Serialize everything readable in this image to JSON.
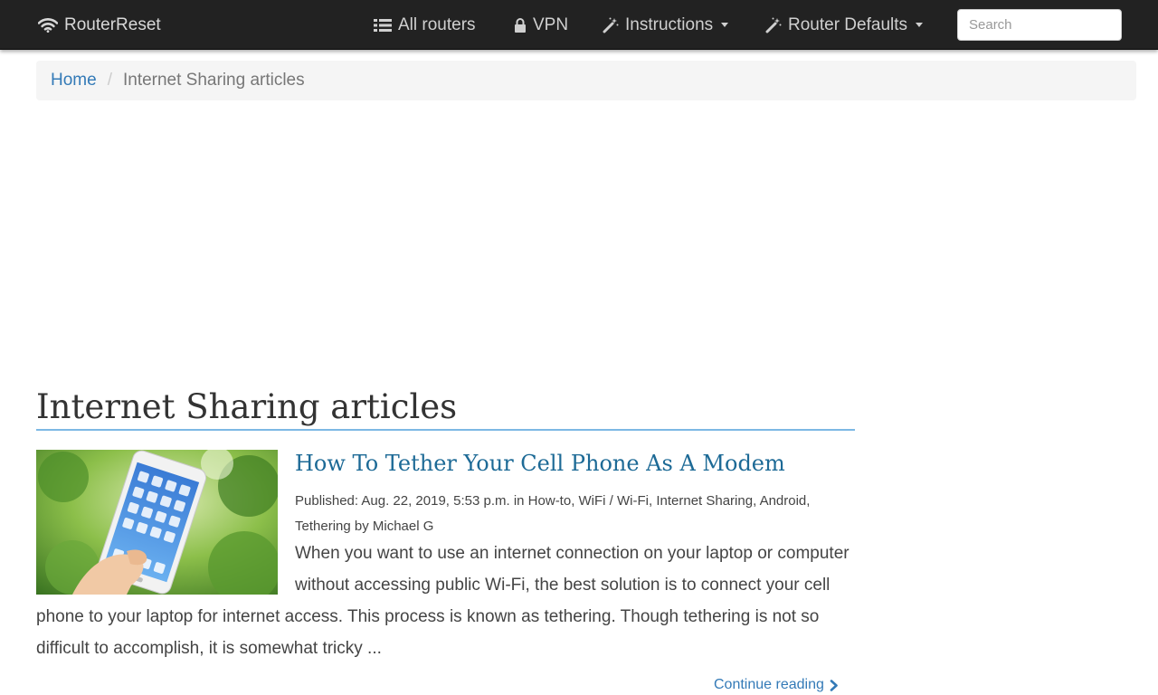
{
  "navbar": {
    "brand": "RouterReset",
    "items": [
      {
        "label": "All routers",
        "icon": "list-icon"
      },
      {
        "label": "VPN",
        "icon": "lock-icon"
      },
      {
        "label": "Instructions",
        "icon": "magic-wand-icon",
        "dropdown": true
      },
      {
        "label": "Router Defaults",
        "icon": "magic-wand-icon",
        "dropdown": true
      }
    ],
    "search_placeholder": "Search"
  },
  "breadcrumb": {
    "home": "Home",
    "separator": "/",
    "current": "Internet Sharing articles"
  },
  "page_title": "Internet Sharing articles",
  "articles": [
    {
      "title": "How To Tether Your Cell Phone As A Modem",
      "meta": "Published: Aug. 22, 2019, 5:53 p.m. in How-to, WiFi / Wi-Fi, Internet Sharing, Android, Tethering by Michael G",
      "excerpt": "When you want to use an internet connection on your laptop or computer without accessing public Wi-Fi, the best solution is to connect your cell phone to your laptop for internet access. This process is known as tethering. Though tethering is not so difficult to accomplish, it is somewhat tricky ...",
      "continue_label": "Continue reading"
    }
  ],
  "colors": {
    "navbar_bg": "#222222",
    "link": "#337ab7",
    "article_title": "#1d6a96",
    "heading_rule": "#7cb8e4"
  }
}
